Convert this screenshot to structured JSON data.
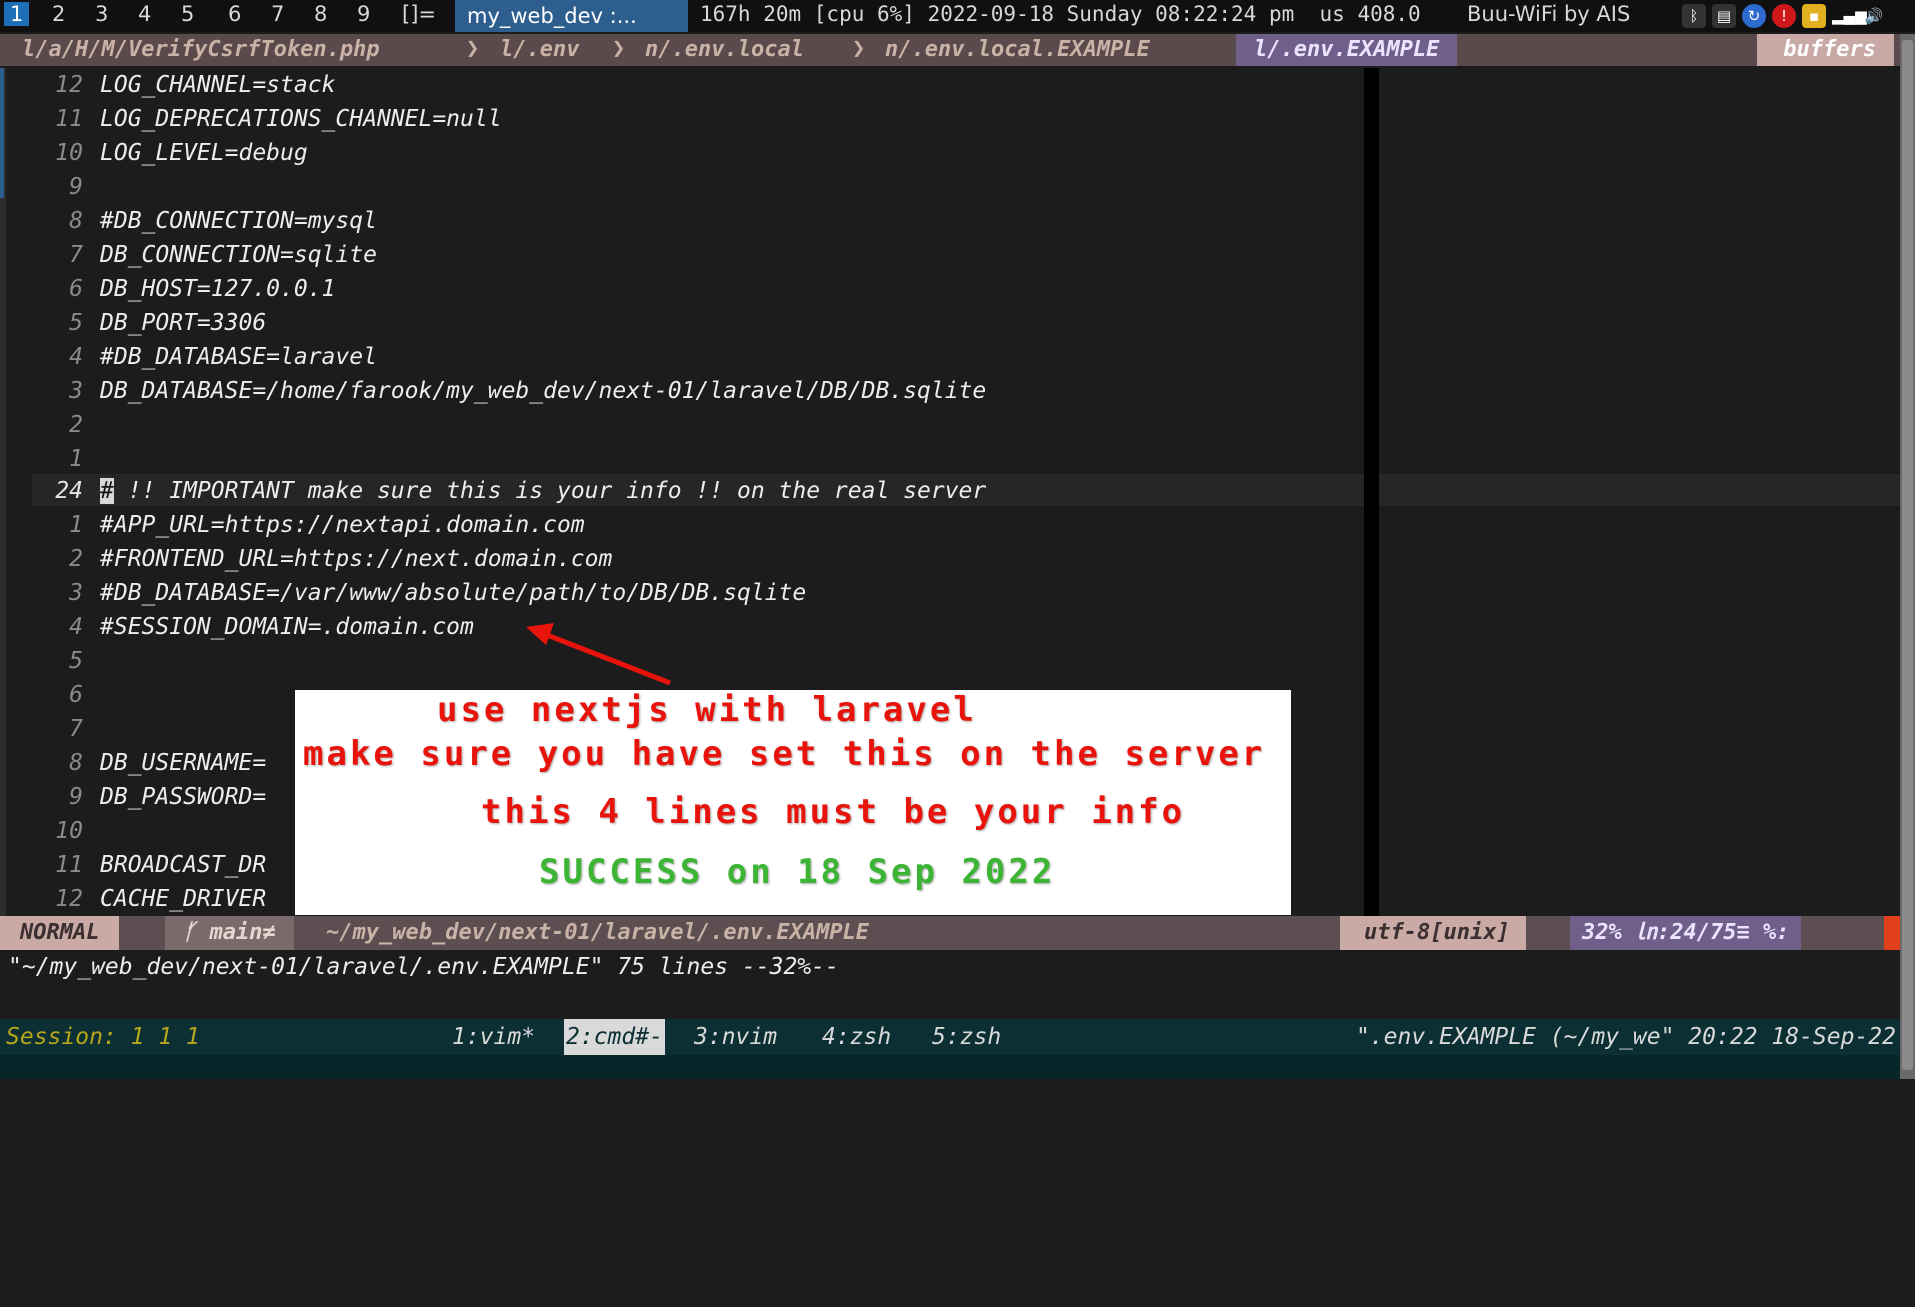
{
  "topbar": {
    "workspaces": [
      "1",
      "2",
      "3",
      "4",
      "5",
      "6",
      "7",
      "8",
      "9"
    ],
    "layout": "[]=",
    "window_title": "my_web_dev :...",
    "status": "167h 20m [cpu 6%] 2022-09-18 Sunday 08:22:24 pm  us 408.0",
    "wifi": "Buu-WiFi by AIS",
    "tray_icons": [
      "bluetooth-icon",
      "clipboard-icon",
      "update-icon",
      "shield-icon",
      "folder-icon",
      "signal-icon",
      "volume-icon"
    ]
  },
  "tabline": {
    "tabs": [
      "l/a/H/M/VerifyCsrfToken.php",
      "l/.env",
      "n/.env.local",
      "n/.env.local.EXAMPLE"
    ],
    "active_tab": "l/.env.EXAMPLE",
    "buffers_label": "buffers",
    "separator": "❯"
  },
  "editor": {
    "lines": [
      {
        "num": "12",
        "text": "LOG_CHANNEL=stack"
      },
      {
        "num": "11",
        "text": "LOG_DEPRECATIONS_CHANNEL=null"
      },
      {
        "num": "10",
        "text": "LOG_LEVEL=debug"
      },
      {
        "num": "9",
        "text": ""
      },
      {
        "num": "8",
        "text": "#DB_CONNECTION=mysql"
      },
      {
        "num": "7",
        "text": "DB_CONNECTION=sqlite"
      },
      {
        "num": "6",
        "text": "DB_HOST=127.0.0.1"
      },
      {
        "num": "5",
        "text": "DB_PORT=3306"
      },
      {
        "num": "4",
        "text": "#DB_DATABASE=laravel"
      },
      {
        "num": "3",
        "text": "DB_DATABASE=/home/farook/my_web_dev/next-01/laravel/DB/DB.sqlite"
      },
      {
        "num": "2",
        "text": ""
      },
      {
        "num": "1",
        "text": ""
      },
      {
        "num": "24",
        "text": "# !! IMPORTANT make sure this is your info !! on the real server"
      },
      {
        "num": "1",
        "text": "#APP_URL=https://nextapi.domain.com"
      },
      {
        "num": "2",
        "text": "#FRONTEND_URL=https://next.domain.com"
      },
      {
        "num": "3",
        "text": "#DB_DATABASE=/var/www/absolute/path/to/DB/DB.sqlite"
      },
      {
        "num": "4",
        "text": "#SESSION_DOMAIN=.domain.com"
      },
      {
        "num": "5",
        "text": ""
      },
      {
        "num": "6",
        "text": ""
      },
      {
        "num": "7",
        "text": ""
      },
      {
        "num": "8",
        "text": "DB_USERNAME="
      },
      {
        "num": "9",
        "text": "DB_PASSWORD="
      },
      {
        "num": "10",
        "text": ""
      },
      {
        "num": "11",
        "text": "BROADCAST_DR"
      },
      {
        "num": "12",
        "text": "CACHE_DRIVER"
      }
    ],
    "current_line_rest": " !! IMPORTANT make sure this is your info !! on the real server",
    "cursor_char": "#"
  },
  "annotation": {
    "line1": "use nextjs with laravel",
    "line2": "make sure you have set this on the server",
    "line3": "this 4 lines must be your info",
    "success": "SUCCESS on 18 Sep 2022"
  },
  "statusline": {
    "mode": "NORMAL",
    "branch": "ᚶ main≠",
    "filepath": "~/my_web_dev/next-01/laravel/.env.EXAMPLE",
    "encoding": "utf-8[unix]",
    "position": "32% ㏑:24/75≡ %:"
  },
  "cmdline": "\"~/my_web_dev/next-01/laravel/.env.EXAMPLE\" 75 lines --32%--",
  "tmux": {
    "session": "Session: 1 1 1",
    "windows": [
      {
        "label": "1:vim*"
      },
      {
        "label": "2:cmd#-"
      },
      {
        "label": "3:nvim"
      },
      {
        "label": "4:zsh"
      },
      {
        "label": "5:zsh"
      }
    ],
    "right": "\".env.EXAMPLE (~/my_we\" 20:22 18-Sep-22"
  },
  "colors": {
    "background": "#1c1c1c",
    "tabline": "#5a4a4c",
    "active_tab": "#6f5f8a",
    "statusline": "#5c4e51",
    "tmux_bar": "#0b2f33",
    "annotation_red": "#e8140c",
    "annotation_green": "#3cb534"
  }
}
